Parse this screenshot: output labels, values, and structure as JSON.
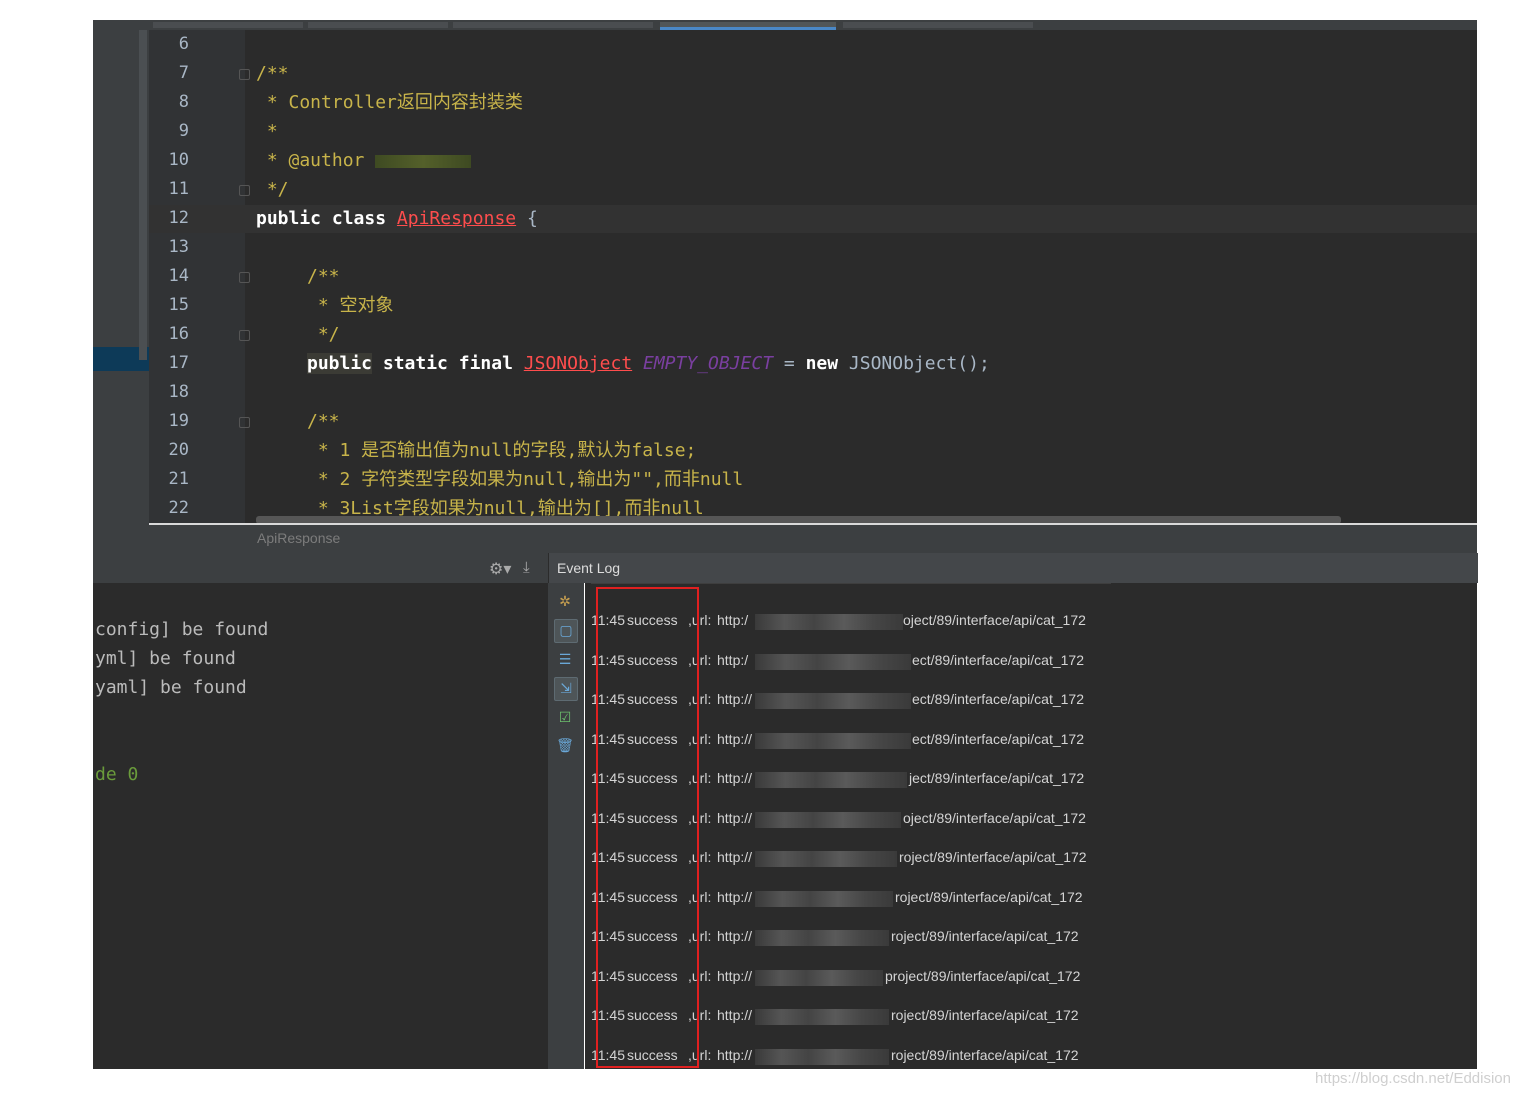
{
  "editor": {
    "file_name": "ApiResponse",
    "lines": [
      {
        "n": "6"
      },
      {
        "n": "7"
      },
      {
        "n": "8"
      },
      {
        "n": "9"
      },
      {
        "n": "10"
      },
      {
        "n": "11"
      },
      {
        "n": "12"
      },
      {
        "n": "13"
      },
      {
        "n": "14"
      },
      {
        "n": "15"
      },
      {
        "n": "16"
      },
      {
        "n": "17"
      },
      {
        "n": "18"
      },
      {
        "n": "19"
      },
      {
        "n": "20"
      },
      {
        "n": "21"
      },
      {
        "n": "22"
      }
    ],
    "code": {
      "l7": "/**",
      "l8": " * Controller返回内容封装类",
      "l9": " *",
      "l10": " * @author",
      "l11": " */",
      "l12_public": "public",
      "l12_class": "class",
      "l12_name": "ApiResponse",
      "l12_brace": " {",
      "l14": "/**",
      "l15": " * 空对象",
      "l16": " */",
      "l17_public": "public",
      "l17_static": "static",
      "l17_final": "final",
      "l17_type": "JSONObject",
      "l17_const": "EMPTY_OBJECT",
      "l17_eq": " = ",
      "l17_new": "new",
      "l17_ctor": " JSONObject();",
      "l19": "/**",
      "l20": " * 1 是否输出值为null的字段,默认为false;",
      "l21": " * 2 字符类型字段如果为null,输出为\"\",而非null",
      "l22": " * 3List字段如果为null,输出为[],而非null"
    }
  },
  "console": {
    "lines": [
      "config] be found",
      "yml] be found",
      "yaml] be found"
    ],
    "exit_line": "de 0"
  },
  "event_log": {
    "title": "Event Log",
    "rows": [
      {
        "time": "11:45",
        "msg": "success",
        "label": ",url:",
        "url_start": "http:/",
        "url_end": "oject/89/interface/api/cat_172"
      },
      {
        "time": "11:45",
        "msg": "success",
        "label": ",url:",
        "url_start": "http:/",
        "url_end": "ect/89/interface/api/cat_172"
      },
      {
        "time": "11:45",
        "msg": "success",
        "label": ",url:",
        "url_start": "http://",
        "url_end": "ect/89/interface/api/cat_172"
      },
      {
        "time": "11:45",
        "msg": "success",
        "label": ",url:",
        "url_start": "http://",
        "url_end": "ect/89/interface/api/cat_172"
      },
      {
        "time": "11:45",
        "msg": "success",
        "label": ",url:",
        "url_start": "http://",
        "url_end": "ject/89/interface/api/cat_172"
      },
      {
        "time": "11:45",
        "msg": "success",
        "label": ",url:",
        "url_start": "http://",
        "url_end": "oject/89/interface/api/cat_172"
      },
      {
        "time": "11:45",
        "msg": "success",
        "label": ",url:",
        "url_start": "http://",
        "url_end": "roject/89/interface/api/cat_172"
      },
      {
        "time": "11:45",
        "msg": "success",
        "label": ",url:",
        "url_start": "http://",
        "url_end": "roject/89/interface/api/cat_172"
      },
      {
        "time": "11:45",
        "msg": "success",
        "label": ",url:",
        "url_start": "http://",
        "url_end": "roject/89/interface/api/cat_172"
      },
      {
        "time": "11:45",
        "msg": "success",
        "label": ",url:",
        "url_start": "http://",
        "url_end": "project/89/interface/api/cat_172"
      },
      {
        "time": "11:45",
        "msg": "success",
        "label": ",url:",
        "url_start": "http://",
        "url_end": "roject/89/interface/api/cat_172"
      },
      {
        "time": "11:45",
        "msg": "success",
        "label": ",url:",
        "url_start": "http://",
        "url_end": "roject/89/interface/api/cat_172"
      }
    ]
  },
  "watermark": "https://blog.csdn.net/Eddision",
  "colors": {
    "editor_bg": "#2b2b2b",
    "doc_comment": "#c8b44a",
    "error_red": "#ff4d4d",
    "highlight_box": "#e02020"
  }
}
